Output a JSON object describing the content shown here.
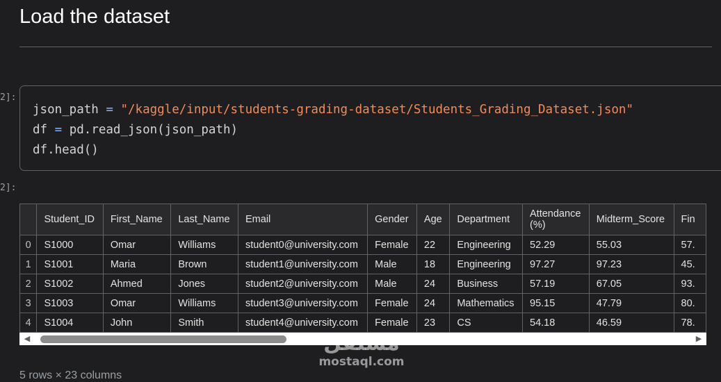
{
  "heading": "Load the dataset",
  "code_cell": {
    "prompt": "2]:",
    "line1": {
      "var": "json_path",
      "op": "=",
      "value": "\"/kaggle/input/students-grading-dataset/Students_Grading_Dataset.json\""
    },
    "line2": {
      "lhs": "df",
      "op": "=",
      "rhs": "pd.read_json(json_path)"
    },
    "line3": "df.head()"
  },
  "output_prompt": "2]:",
  "table": {
    "columns": [
      "",
      "Student_ID",
      "First_Name",
      "Last_Name",
      "Email",
      "Gender",
      "Age",
      "Department",
      "Attendance (%)",
      "Midterm_Score",
      "Fin"
    ],
    "rows": [
      [
        "0",
        "S1000",
        "Omar",
        "Williams",
        "student0@university.com",
        "Female",
        "22",
        "Engineering",
        "52.29",
        "55.03",
        "57."
      ],
      [
        "1",
        "S1001",
        "Maria",
        "Brown",
        "student1@university.com",
        "Male",
        "18",
        "Engineering",
        "97.27",
        "97.23",
        "45."
      ],
      [
        "2",
        "S1002",
        "Ahmed",
        "Jones",
        "student2@university.com",
        "Male",
        "24",
        "Business",
        "57.19",
        "67.05",
        "93."
      ],
      [
        "3",
        "S1003",
        "Omar",
        "Williams",
        "student3@university.com",
        "Female",
        "24",
        "Mathematics",
        "95.15",
        "47.79",
        "80."
      ],
      [
        "4",
        "S1004",
        "John",
        "Smith",
        "student4@university.com",
        "Female",
        "23",
        "CS",
        "54.18",
        "46.59",
        "78."
      ]
    ]
  },
  "scrollbar": {
    "left_arrow": "◀",
    "right_arrow": "▶"
  },
  "footer": "5 rows × 23 columns",
  "watermark": {
    "arabic": "مستقل",
    "latin": "mostaql.com"
  }
}
